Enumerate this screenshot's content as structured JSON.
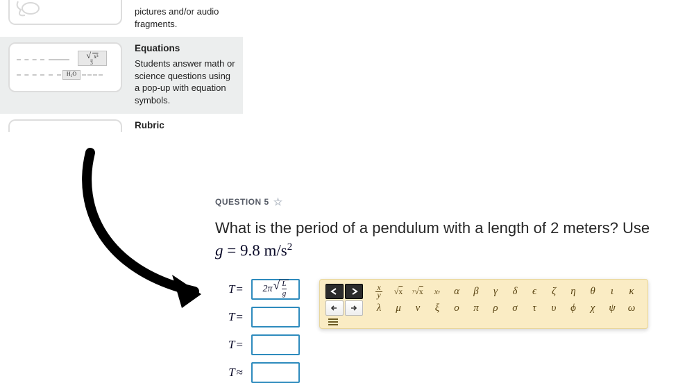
{
  "sidebar": {
    "items": [
      {
        "title": "",
        "desc_tail": "pictures and/or audio fragments."
      },
      {
        "title": "Equations",
        "desc": "Students answer math or science questions using a pop-up with equation symbols."
      },
      {
        "title": "Rubric",
        "desc": ""
      }
    ]
  },
  "question": {
    "label": "QUESTION 5",
    "text": "What is the period of a pendulum with a length of 2 meters? Use",
    "given_var": "g",
    "given_eq": " = ",
    "given_val": "9.8",
    "given_unit_m": "m",
    "given_unit_slash": "/",
    "given_unit_s": "s",
    "given_unit_exp": "2"
  },
  "answers": {
    "rows": [
      {
        "lhs_var": "T",
        "lhs_op": "=",
        "value": "2π√(L/g)",
        "num": "L",
        "den": "g",
        "coef": "2π"
      },
      {
        "lhs_var": "T",
        "lhs_op": "=",
        "value": ""
      },
      {
        "lhs_var": "T",
        "lhs_op": "=",
        "value": ""
      },
      {
        "lhs_var": "T",
        "lhs_op": "≈",
        "value": ""
      }
    ]
  },
  "picker": {
    "nav": {
      "undo": "undo",
      "redo": "redo",
      "left": "left",
      "right": "right"
    },
    "row1": [
      "x/y",
      "√x",
      "∛x",
      "xʸ",
      "α",
      "β",
      "γ",
      "δ",
      "ϵ",
      "ζ",
      "η",
      "θ",
      "ι",
      "κ"
    ],
    "row2": [
      "λ",
      "μ",
      "ν",
      "ξ",
      "ο",
      "π",
      "ρ",
      "σ",
      "τ",
      "υ",
      "ϕ",
      "χ",
      "ψ",
      "ω"
    ]
  },
  "icons": {
    "star": "☆"
  }
}
